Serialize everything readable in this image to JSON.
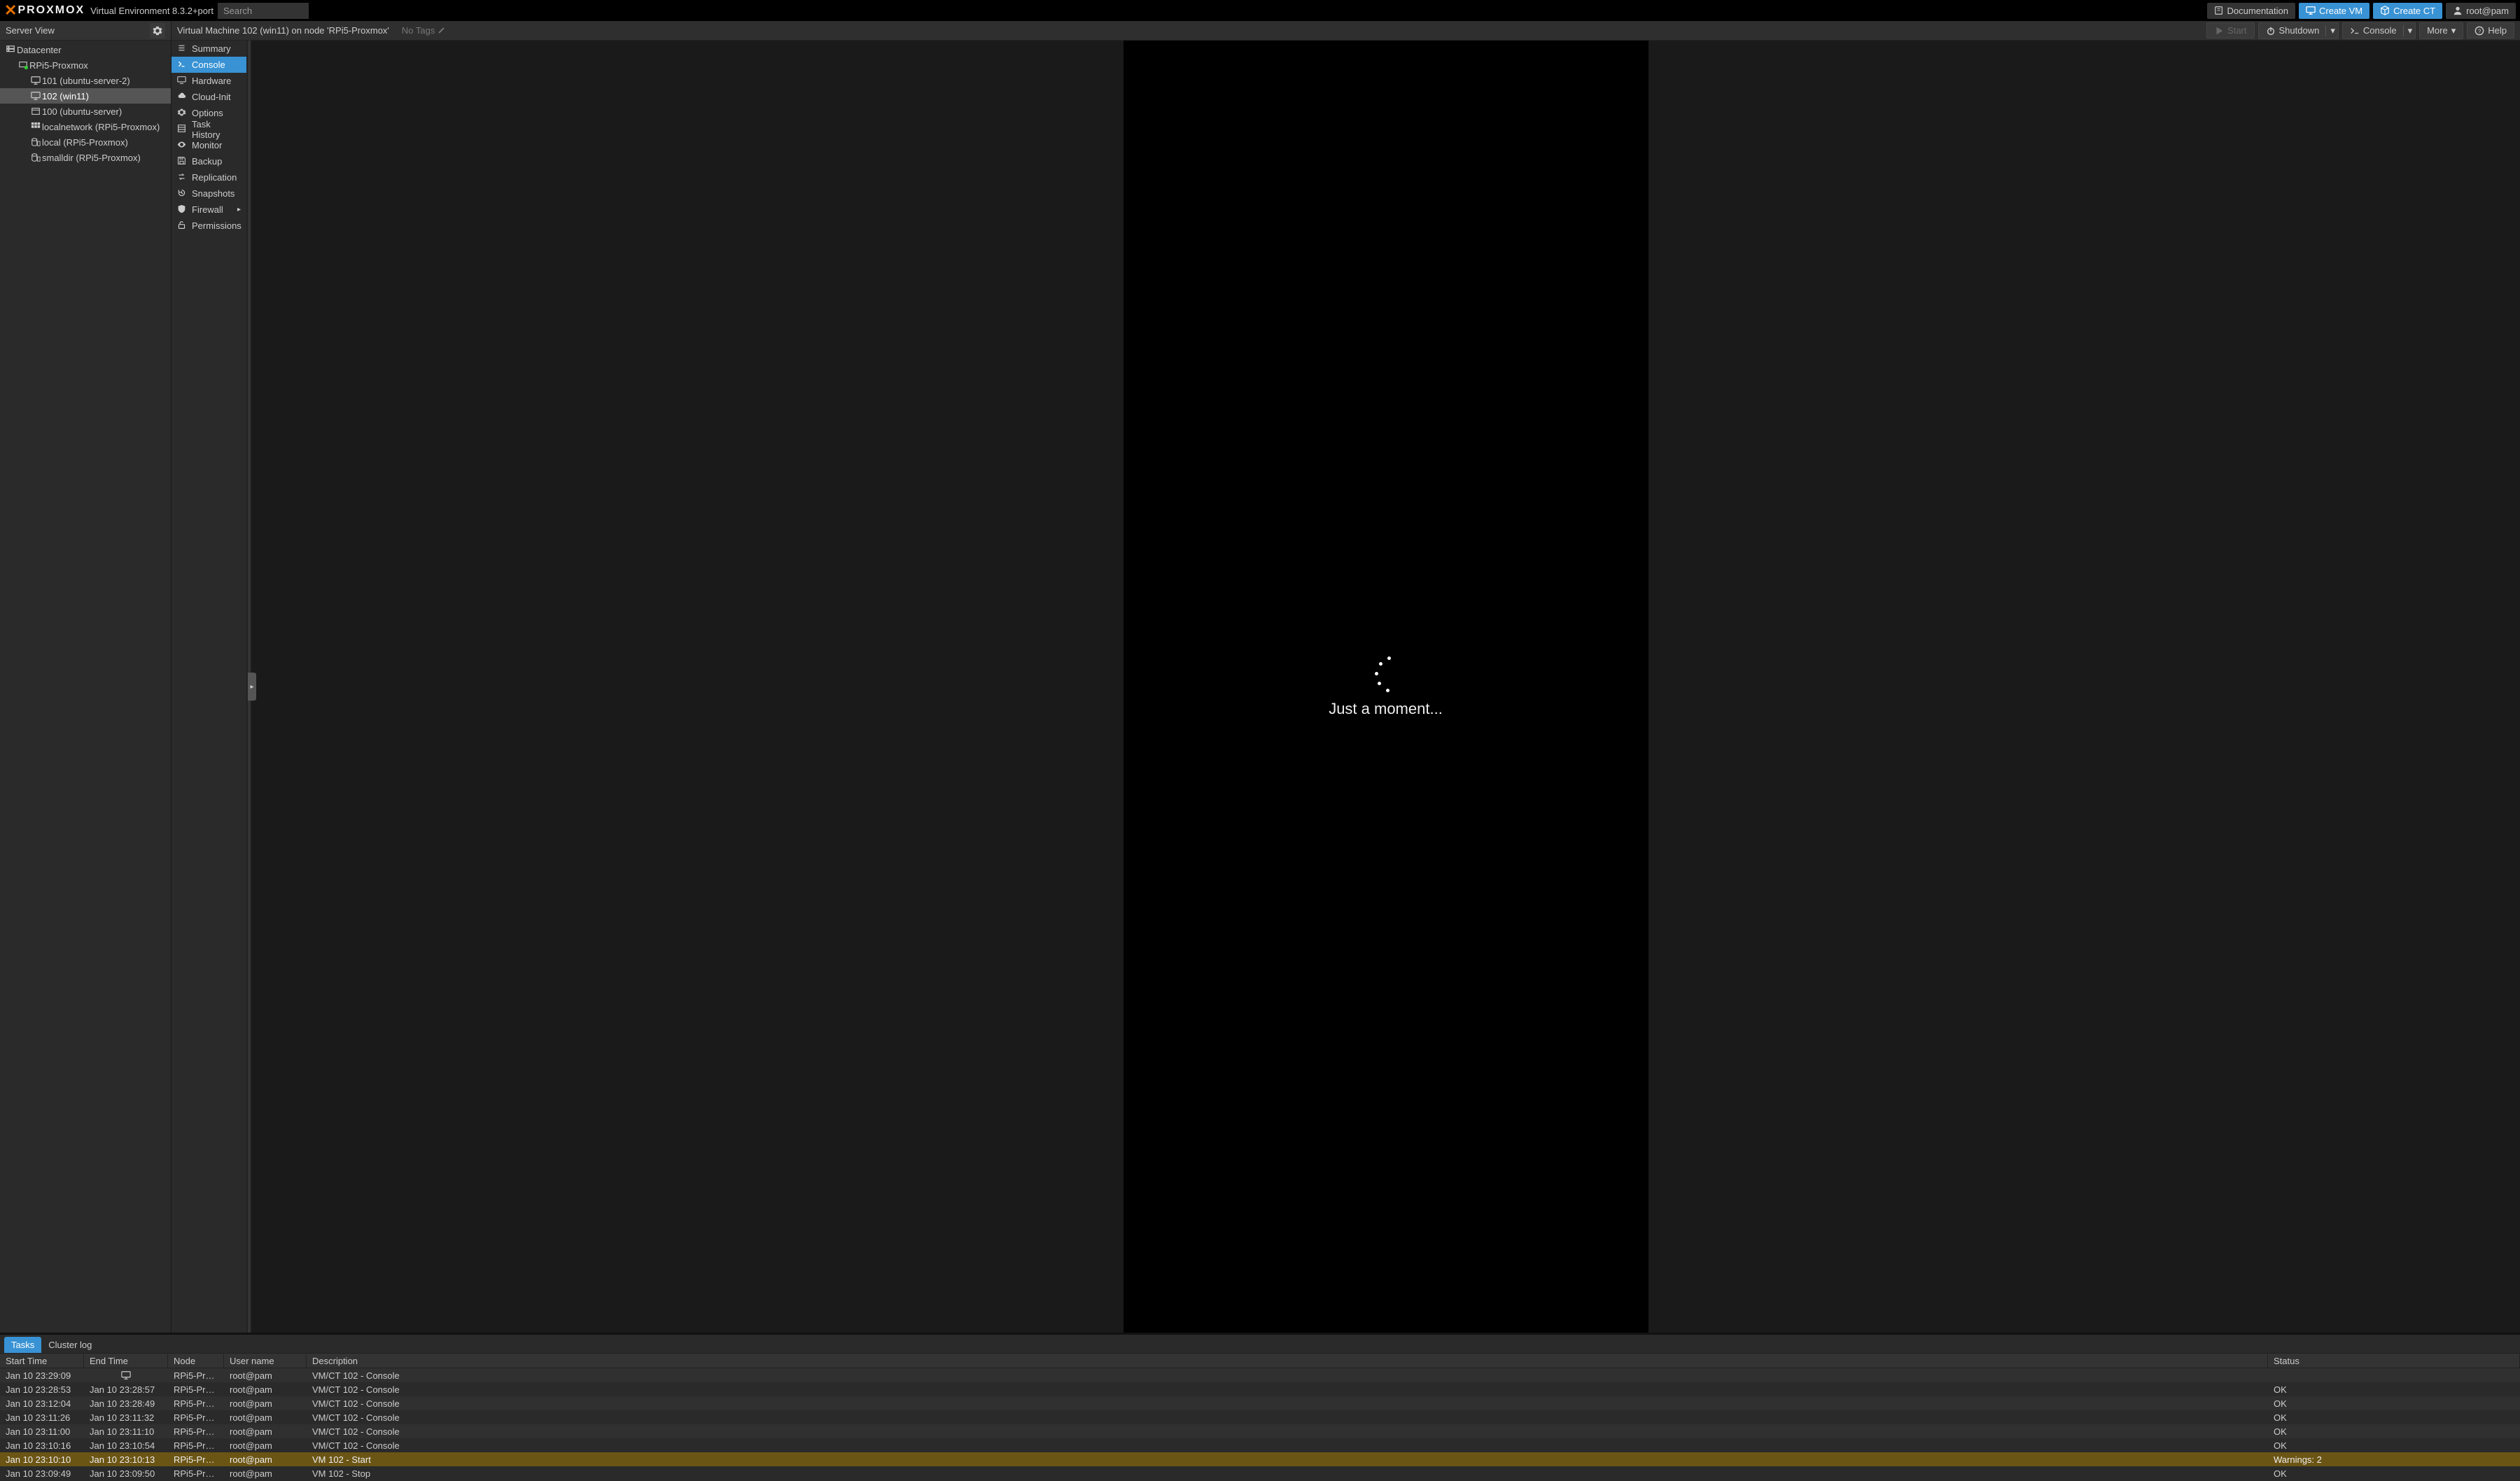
{
  "header": {
    "logo_name": "PROXMOX",
    "ve": "Virtual Environment 8.3.2+port",
    "search_placeholder": "Search",
    "documentation": "Documentation",
    "create_vm": "Create VM",
    "create_ct": "Create CT",
    "user": "root@pam"
  },
  "tree": {
    "header": "Server View",
    "nodes": [
      {
        "label": "Datacenter",
        "level": 0,
        "icon": "server"
      },
      {
        "label": "RPi5-Proxmox",
        "level": 1,
        "icon": "node-green"
      },
      {
        "label": "101 (ubuntu-server-2)",
        "level": 2,
        "icon": "vm"
      },
      {
        "label": "102 (win11)",
        "level": 2,
        "icon": "vm",
        "selected": true
      },
      {
        "label": "100 (ubuntu-server)",
        "level": 2,
        "icon": "ct"
      },
      {
        "label": "localnetwork (RPi5-Proxmox)",
        "level": 2,
        "icon": "net"
      },
      {
        "label": "local (RPi5-Proxmox)",
        "level": 2,
        "icon": "storage"
      },
      {
        "label": "smalldir (RPi5-Proxmox)",
        "level": 2,
        "icon": "storage"
      }
    ]
  },
  "content": {
    "title": "Virtual Machine 102 (win11) on node 'RPi5-Proxmox'",
    "no_tags": "No Tags",
    "buttons": {
      "start": "Start",
      "shutdown": "Shutdown",
      "console": "Console",
      "more": "More",
      "help": "Help"
    },
    "subnav": [
      {
        "icon": "list",
        "label": "Summary"
      },
      {
        "icon": "terminal",
        "label": "Console",
        "active": true
      },
      {
        "icon": "monitor",
        "label": "Hardware"
      },
      {
        "icon": "cloud",
        "label": "Cloud-Init"
      },
      {
        "icon": "gear",
        "label": "Options"
      },
      {
        "icon": "list2",
        "label": "Task History"
      },
      {
        "icon": "eye",
        "label": "Monitor"
      },
      {
        "icon": "save",
        "label": "Backup"
      },
      {
        "icon": "replication",
        "label": "Replication"
      },
      {
        "icon": "history",
        "label": "Snapshots"
      },
      {
        "icon": "shield",
        "label": "Firewall",
        "submenu": true
      },
      {
        "icon": "unlock",
        "label": "Permissions"
      }
    ],
    "loading_text": "Just a moment..."
  },
  "log": {
    "tabs": {
      "tasks": "Tasks",
      "cluster": "Cluster log"
    },
    "columns": {
      "start": "Start Time",
      "end": "End Time",
      "node": "Node",
      "user": "User name",
      "desc": "Description",
      "status": "Status"
    },
    "rows": [
      {
        "start": "Jan 10 23:29:09",
        "end_running": true,
        "node": "RPi5-Prox...",
        "user": "root@pam",
        "desc": "VM/CT 102 - Console",
        "status": ""
      },
      {
        "start": "Jan 10 23:28:53",
        "end": "Jan 10 23:28:57",
        "node": "RPi5-Prox...",
        "user": "root@pam",
        "desc": "VM/CT 102 - Console",
        "status": "OK"
      },
      {
        "start": "Jan 10 23:12:04",
        "end": "Jan 10 23:28:49",
        "node": "RPi5-Prox...",
        "user": "root@pam",
        "desc": "VM/CT 102 - Console",
        "status": "OK"
      },
      {
        "start": "Jan 10 23:11:26",
        "end": "Jan 10 23:11:32",
        "node": "RPi5-Prox...",
        "user": "root@pam",
        "desc": "VM/CT 102 - Console",
        "status": "OK"
      },
      {
        "start": "Jan 10 23:11:00",
        "end": "Jan 10 23:11:10",
        "node": "RPi5-Prox...",
        "user": "root@pam",
        "desc": "VM/CT 102 - Console",
        "status": "OK"
      },
      {
        "start": "Jan 10 23:10:16",
        "end": "Jan 10 23:10:54",
        "node": "RPi5-Prox...",
        "user": "root@pam",
        "desc": "VM/CT 102 - Console",
        "status": "OK"
      },
      {
        "start": "Jan 10 23:10:10",
        "end": "Jan 10 23:10:13",
        "node": "RPi5-Prox...",
        "user": "root@pam",
        "desc": "VM 102 - Start",
        "status": "Warnings: 2",
        "warning": true
      },
      {
        "start": "Jan 10 23:09:49",
        "end": "Jan 10 23:09:50",
        "node": "RPi5-Prox...",
        "user": "root@pam",
        "desc": "VM 102 - Stop",
        "status": "OK"
      }
    ]
  }
}
